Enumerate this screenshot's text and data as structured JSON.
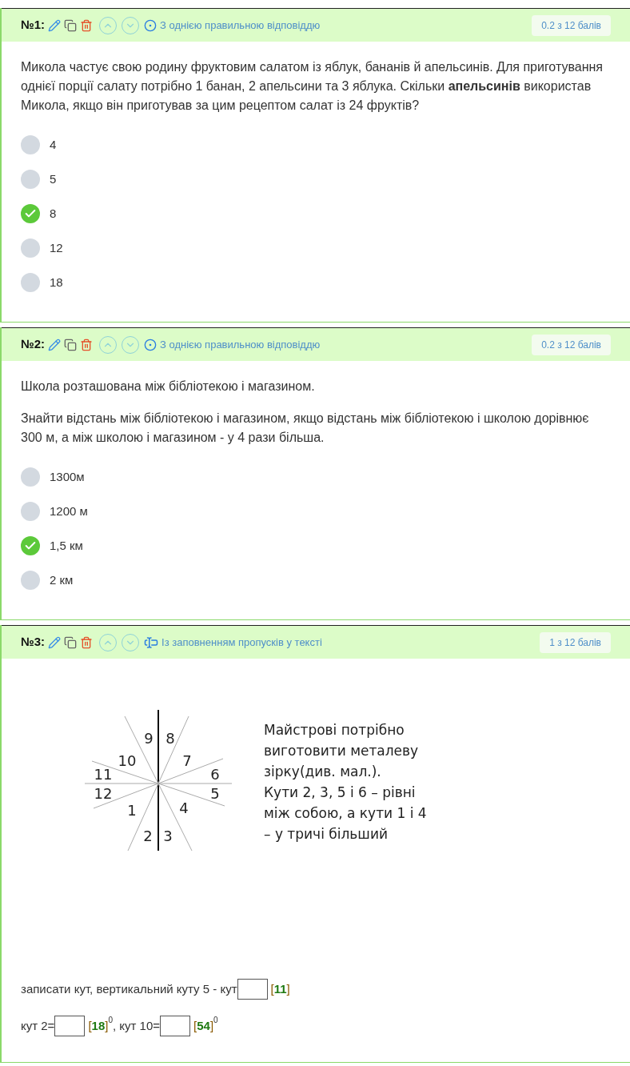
{
  "questions": [
    {
      "number": "№1:",
      "kind": "single",
      "type_label": "З однією правильною відповіддю",
      "score": "0.2 з 12 балів",
      "body": [
        {
          "kind": "paragraph",
          "text": "Микола частує свою родину фруктовим салатом із яблук, бананів й апельсинів. Для приготування однієї порції салату потрібно 1 банан, 2 апельсини та 3 яблука. Скільки **апельсинів** використав Микола, якщо він приготував за цим рецептом салат із 24 фруктів?"
        }
      ],
      "options": [
        {
          "label": "4",
          "correct": false
        },
        {
          "label": "5",
          "correct": false
        },
        {
          "label": "8",
          "correct": true
        },
        {
          "label": "12",
          "correct": false
        },
        {
          "label": "18",
          "correct": false
        }
      ]
    },
    {
      "number": "№2:",
      "kind": "single",
      "type_label": "З однією правильною відповіддю",
      "score": "0.2 з 12 балів",
      "body": [
        {
          "kind": "paragraph",
          "text": "Школа розташована між бібліотекою і магазином."
        },
        {
          "kind": "paragraph",
          "text": "Знайти відстань між бібліотекою і магазином, якщо відстань між бібліотекою і школою дорівнює 300 м, а між школою і магазином - у 4 рази більша."
        }
      ],
      "options": [
        {
          "label": "1300м",
          "correct": false
        },
        {
          "label": "1200 м",
          "correct": false
        },
        {
          "label": "1,5 км",
          "correct": true
        },
        {
          "label": "2 км",
          "correct": false
        }
      ]
    },
    {
      "number": "№3:",
      "kind": "fill",
      "type_label": "Із заповненням пропусків у тексті",
      "score": "1 з 12 балів",
      "body": [
        {
          "kind": "figure",
          "angle_labels": [
            "9",
            "8",
            "10",
            "7",
            "11",
            "6",
            "12",
            "5",
            "1",
            "4",
            "2",
            "3"
          ],
          "lines": [
            "Майстрові потрібно",
            "виготовити металеву",
            "зірку(див. мал.).",
            "Кути 2, 3, 5 і 6 – рівні",
            "між собою, а кути 1 і 4",
            "– у тричі більший"
          ]
        },
        {
          "kind": "blanks",
          "parts": [
            {
              "kind": "text",
              "text": "записати кут, вертикальний куту 5 - кут"
            },
            {
              "kind": "blank",
              "open": "[",
              "answer": "11",
              "close": "]"
            }
          ]
        },
        {
          "kind": "blanks",
          "parts": [
            {
              "kind": "text",
              "text": "кут 2="
            },
            {
              "kind": "blank",
              "open": "[",
              "answer": "18",
              "close": "]"
            },
            {
              "kind": "sup",
              "text": "0"
            },
            {
              "kind": "text",
              "text": ", кут 10="
            },
            {
              "kind": "blank",
              "open": "[",
              "answer": "54",
              "close": "]"
            },
            {
              "kind": "sup",
              "text": "0"
            }
          ]
        }
      ]
    }
  ]
}
